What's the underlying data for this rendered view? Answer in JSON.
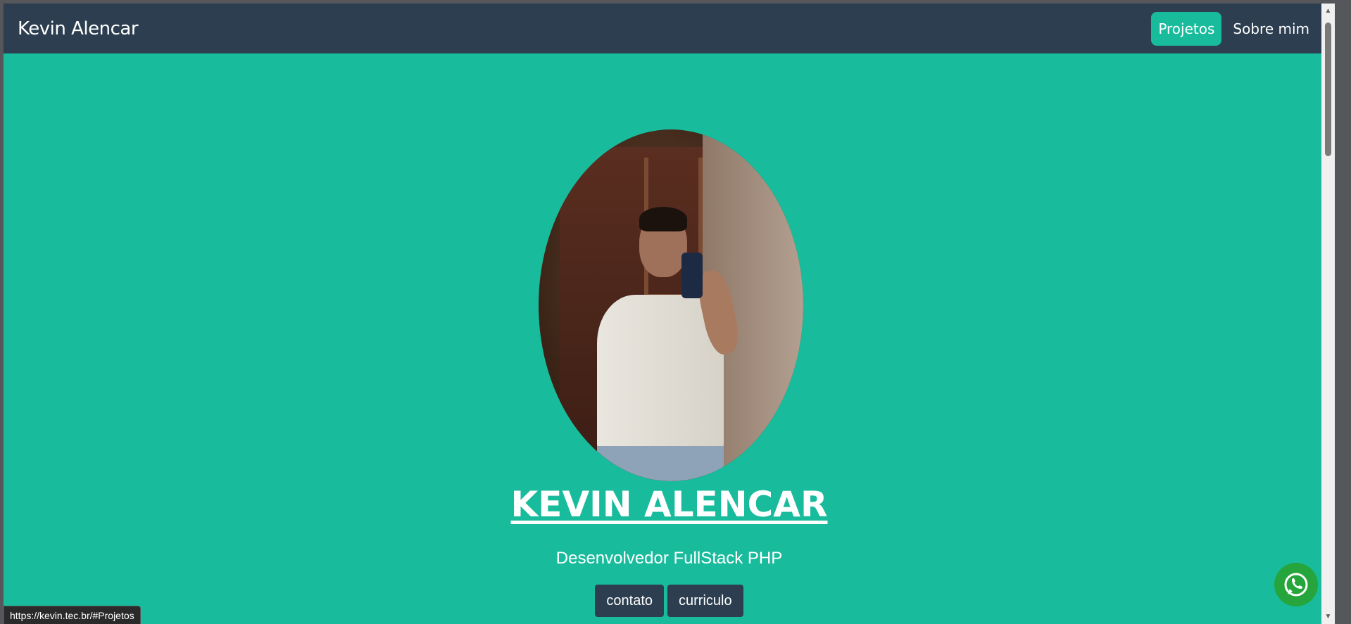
{
  "navbar": {
    "brand": "Kevin Alencar",
    "items": [
      {
        "label": "Projetos",
        "active": true
      },
      {
        "label": "Sobre mim",
        "active": false
      }
    ]
  },
  "hero": {
    "name": "KEVIN ALENCAR",
    "subtitle": "Desenvolvedor FullStack PHP",
    "buttons": [
      {
        "label": "contato"
      },
      {
        "label": "curriculo"
      }
    ]
  },
  "status_bar": {
    "url": "https://kevin.tec.br/#Projetos"
  },
  "colors": {
    "navbar": "#2c3e50",
    "accent": "#18bc9c",
    "whatsapp": "#25a53b"
  },
  "icons": {
    "whatsapp": "whatsapp-icon"
  }
}
